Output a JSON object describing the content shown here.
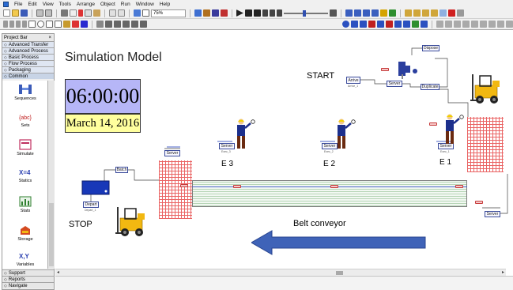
{
  "menubar": {
    "items": [
      "File",
      "Edit",
      "View",
      "Tools",
      "Arrange",
      "Object",
      "Run",
      "Window",
      "Help"
    ]
  },
  "toolbar": {
    "zoom_value": "75%"
  },
  "project_bar": {
    "title": "Project Bar",
    "top_panels": [
      "Advanced Transfer",
      "Advanced Process",
      "Basic Process",
      "Flow Process",
      "Packaging",
      "Common"
    ],
    "modules": [
      "Sequences",
      "Sets",
      "Simulate",
      "Statics",
      "Stats",
      "Storage",
      "Variables"
    ],
    "bottom_panels": [
      "Support",
      "Reports",
      "Navigate"
    ]
  },
  "canvas": {
    "title": "Simulation Model",
    "clock": "06:00:00",
    "date": "March 14, 2016",
    "start_label": "START",
    "stop_label": "STOP",
    "belt_label": "Belt conveyor",
    "stations": [
      "E 3",
      "E 2",
      "E 1"
    ],
    "modules": {
      "dispose": "Dispose",
      "arrive": "Arrive",
      "server": "Server",
      "duplicate": "Duplicate",
      "batch": "Batch",
      "depart": "Depart"
    },
    "module_tags": {
      "arrive": "Arrive_1",
      "depart": "Depart_1",
      "station_3": "Exec_3",
      "station_2": "Exec_2",
      "station_1": "Exec_1"
    }
  },
  "colors": {
    "clock_bg": "#b6b6f7",
    "date_bg": "#ffff9e",
    "grid_zone": "#e74a4a",
    "arrow": "#3f63b8",
    "forklift": "#f2b811"
  }
}
